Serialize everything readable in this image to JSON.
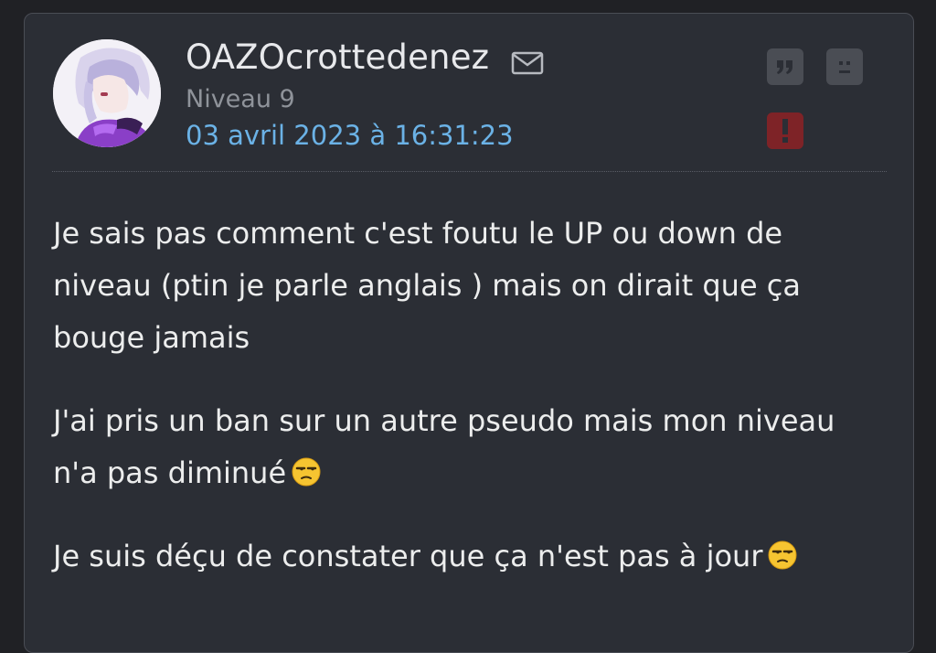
{
  "post": {
    "author": "OAZOcrottedenez",
    "level": "Niveau 9",
    "date": "03 avril 2023 à 16:31:23",
    "paragraphs": [
      "Je sais pas comment c'est foutu le UP ou down de niveau (ptin je parle anglais ) mais on dirait que ça bouge jamais",
      "J'ai pris un ban sur un autre pseudo mais mon niveau n'a pas diminué",
      "Je suis déçu de constater que ça n'est pas à jour"
    ]
  },
  "icons": {
    "mail": "envelope-icon",
    "quote": "quote-icon",
    "sad": "sad-face-icon",
    "report": "exclamation-icon",
    "emoji": "unamused-face-emoji"
  },
  "colors": {
    "page_background": "#202125",
    "card_background": "#2b2e35",
    "date_link": "#6bb2e6",
    "report_button": "#7e2327"
  }
}
